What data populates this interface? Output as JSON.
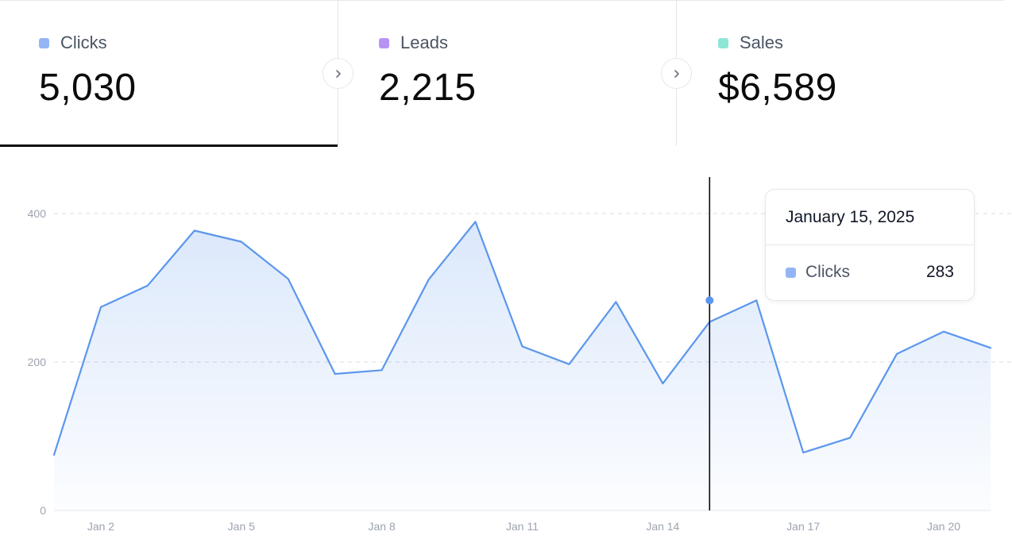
{
  "metrics": [
    {
      "label": "Clicks",
      "value": "5,030",
      "color": "#93b5f5",
      "active": true
    },
    {
      "label": "Leads",
      "value": "2,215",
      "color": "#b794f4",
      "active": false
    },
    {
      "label": "Sales",
      "value": "$6,589",
      "color": "#8ee5d6",
      "active": false
    }
  ],
  "tooltip": {
    "date": "January 15, 2025",
    "series_label": "Clicks",
    "value": "283",
    "color": "#93b5f5"
  },
  "chart_data": {
    "type": "area",
    "series": [
      {
        "name": "Clicks",
        "color": "#5b96ec",
        "values": [
          75,
          274,
          303,
          377,
          362,
          312,
          184,
          189,
          311,
          389,
          221,
          197,
          281,
          171,
          254,
          283,
          78,
          98,
          211,
          241,
          219
        ]
      }
    ],
    "x": [
      "Jan 1",
      "Jan 2",
      "Jan 3",
      "Jan 4",
      "Jan 5",
      "Jan 6",
      "Jan 7",
      "Jan 8",
      "Jan 9",
      "Jan 10",
      "Jan 11",
      "Jan 12",
      "Jan 13",
      "Jan 14",
      "Jan 15",
      "Jan 16",
      "Jan 17",
      "Jan 18",
      "Jan 19",
      "Jan 20",
      "Jan 21"
    ],
    "x_ticks": [
      "Jan 2",
      "Jan 5",
      "Jan 8",
      "Jan 11",
      "Jan 14",
      "Jan 17",
      "Jan 20"
    ],
    "y_ticks": [
      "0",
      "200",
      "400"
    ],
    "ylim": [
      0,
      400
    ],
    "grid": "horizontal dashed",
    "highlight": {
      "x": "Jan 15",
      "value": 283
    }
  }
}
